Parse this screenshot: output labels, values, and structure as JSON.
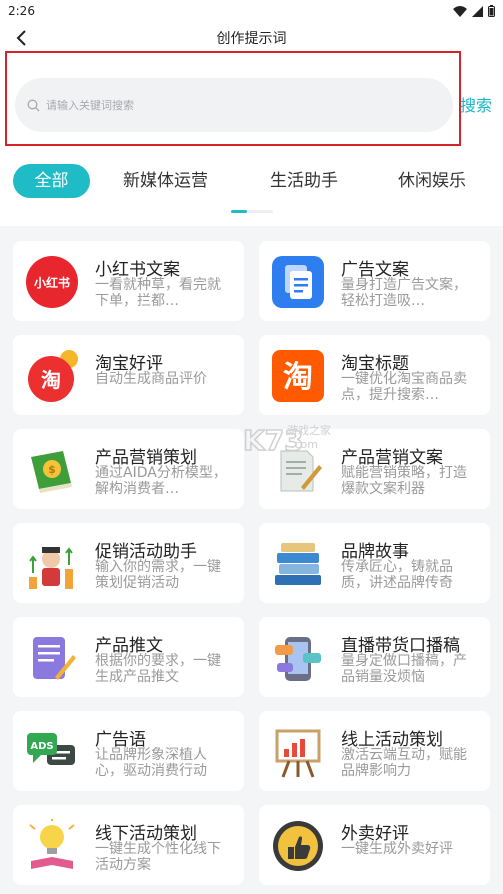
{
  "status": {
    "time": "2:26"
  },
  "nav": {
    "title": "创作提示词"
  },
  "search": {
    "placeholder": "请输入关键词搜索",
    "button": "搜索"
  },
  "tabs": [
    {
      "label": "全部",
      "active": true
    },
    {
      "label": "新媒体运营"
    },
    {
      "label": "生活助手"
    },
    {
      "label": "休闲娱乐"
    }
  ],
  "cards": [
    {
      "icon": "xiaohongshu-logo-icon",
      "logo": "小红书",
      "title": "小红书文案",
      "desc": "一看就种草，看完就下单，拦都…"
    },
    {
      "icon": "document-copy-icon",
      "title": "广告文案",
      "desc": "量身打造广告文案，轻松打造吸…"
    },
    {
      "icon": "taobao-review-icon",
      "logo": "淘",
      "title": "淘宝好评",
      "desc": "自动生成商品评价"
    },
    {
      "icon": "taobao-logo-icon",
      "logo": "淘",
      "title": "淘宝标题",
      "desc": "一键优化淘宝商品卖点，提升搜索…"
    },
    {
      "icon": "money-book-icon",
      "title": "产品营销策划",
      "desc": "通过AIDA分析模型，解构消费者…"
    },
    {
      "icon": "document-pen-icon",
      "title": "产品营销文案",
      "desc": "赋能营销策略，打造爆款文案利器"
    },
    {
      "icon": "promotion-growth-icon",
      "title": "促销活动助手",
      "desc": "输入你的需求，一键策划促销活动"
    },
    {
      "icon": "book-stack-icon",
      "title": "品牌故事",
      "desc": "传承匠心，铸就品质，讲述品牌传奇"
    },
    {
      "icon": "notepad-pen-icon",
      "title": "产品推文",
      "desc": "根据你的要求，一键生成产品推文"
    },
    {
      "icon": "phone-chat-icon",
      "title": "直播带货口播稿",
      "desc": "量身定做口播稿，产品销量没烦恼"
    },
    {
      "icon": "ads-chat-icon",
      "logo": "ADS",
      "title": "广告语",
      "desc": "让品牌形象深植人心，驱动消费行动"
    },
    {
      "icon": "easel-chart-icon",
      "title": "线上活动策划",
      "desc": "激活云端互动，赋能品牌影响力"
    },
    {
      "icon": "lightbulb-book-icon",
      "title": "线下活动策划",
      "desc": "一键生成个性化线下活动方案"
    },
    {
      "icon": "thumbs-up-badge-icon",
      "title": "外卖好评",
      "desc": "一键生成外卖好评"
    }
  ],
  "watermark": {
    "logo": "K73",
    "text": "游戏之家",
    "url": ".com"
  },
  "colors": {
    "accent": "#1fbcc7",
    "highlight_frame": "#d6232a"
  }
}
